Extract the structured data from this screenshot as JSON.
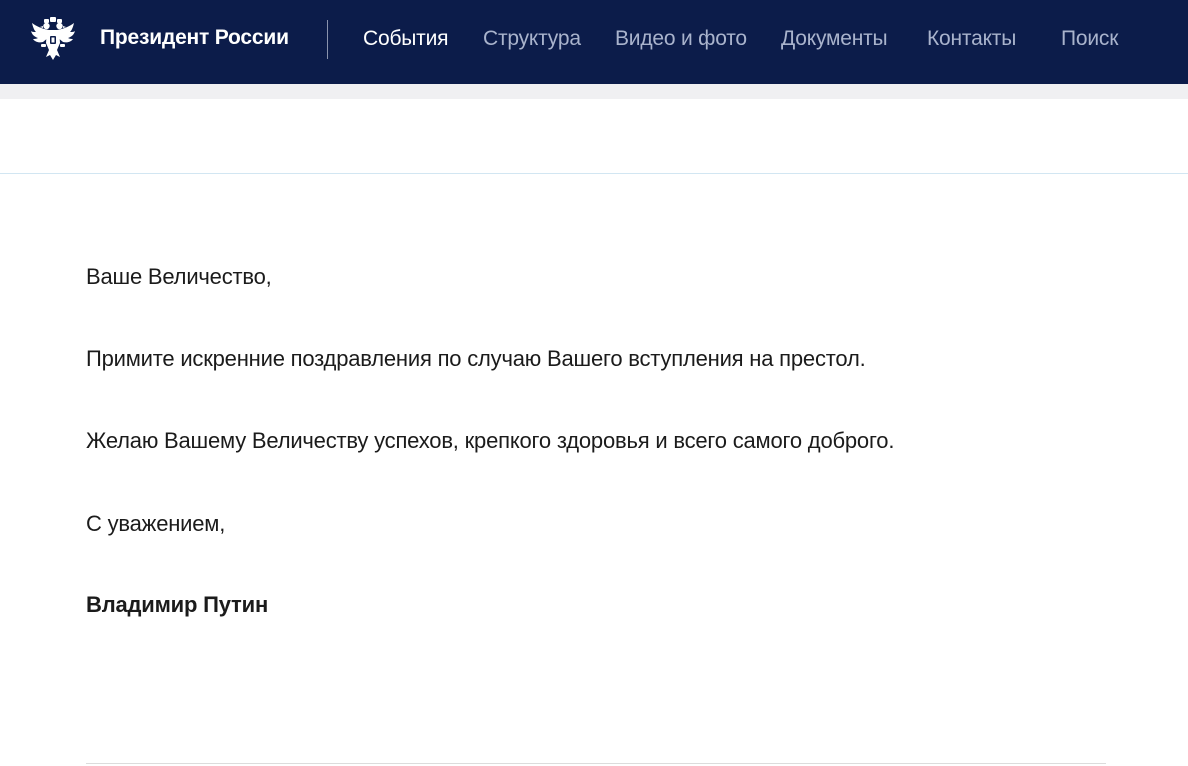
{
  "header": {
    "brand": "Президент России",
    "nav": [
      {
        "label": "События",
        "active": true
      },
      {
        "label": "Структура",
        "active": false
      },
      {
        "label": "Видео и фото",
        "active": false
      },
      {
        "label": "Документы",
        "active": false
      },
      {
        "label": "Контакты",
        "active": false
      },
      {
        "label": "Поиск",
        "active": false
      }
    ],
    "logo_icon": "double-headed-eagle-icon"
  },
  "letter": {
    "salutation": "Ваше Величество,",
    "paragraphs": [
      "Примите искренние поздравления по случаю Вашего вступления на престол.",
      "Желаю Вашему Величеству успехов, крепкого здоровья и всего самого доброго."
    ],
    "closing": "С уважением,",
    "signature": "Владимир Путин"
  },
  "colors": {
    "header_bg": "#0c1c4a",
    "nav_active": "#ffffff",
    "nav_inactive": "#a9b3cc",
    "text": "#1b1b1b"
  }
}
